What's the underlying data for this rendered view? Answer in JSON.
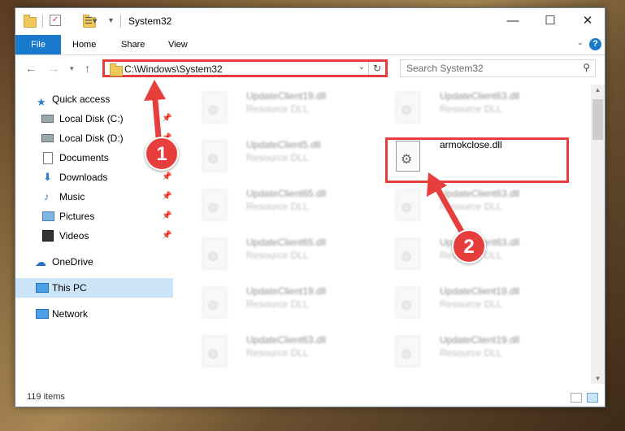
{
  "window": {
    "title": "System32",
    "controls": {
      "minimize": "—",
      "maximize": "☐",
      "close": "✕"
    }
  },
  "ribbon": {
    "tabs": [
      "File",
      "Home",
      "Share",
      "View"
    ],
    "help": "?"
  },
  "address": {
    "path": "C:\\Windows\\System32",
    "search_placeholder": "Search System32"
  },
  "nav_pane": {
    "items": [
      {
        "label": "Quick access",
        "icon": "star-icon",
        "pinned": false
      },
      {
        "label": "Local Disk (C:)",
        "icon": "drive-icon",
        "pinned": true
      },
      {
        "label": "Local Disk (D:)",
        "icon": "drive-icon",
        "pinned": true
      },
      {
        "label": "Documents",
        "icon": "documents-icon",
        "pinned": true
      },
      {
        "label": "Downloads",
        "icon": "download-icon",
        "pinned": true
      },
      {
        "label": "Music",
        "icon": "music-icon",
        "pinned": true
      },
      {
        "label": "Pictures",
        "icon": "pictures-icon",
        "pinned": true
      },
      {
        "label": "Videos",
        "icon": "videos-icon",
        "pinned": true
      },
      {
        "label": "OneDrive",
        "icon": "cloud-icon",
        "pinned": false
      },
      {
        "label": "This PC",
        "icon": "computer-icon",
        "pinned": false,
        "selected": true
      },
      {
        "label": "Network",
        "icon": "network-icon",
        "pinned": false
      }
    ]
  },
  "files": {
    "left_column": [
      {
        "name": "UpdateClient19.dll",
        "type": "Resource DLL"
      },
      {
        "name": "UpdateClient5.dll",
        "type": "Resource DLL"
      },
      {
        "name": "UpdateClient65.dll",
        "type": "Resource DLL"
      },
      {
        "name": "UpdateClient65.dll",
        "type": "Resource DLL"
      },
      {
        "name": "UpdateClient19.dll",
        "type": "Resource DLL"
      },
      {
        "name": "UpdateClient63.dll",
        "type": "Resource DLL"
      }
    ],
    "right_column": [
      {
        "name": "UpdateClient63.dll",
        "type": "Resource DLL"
      },
      {
        "name": "armokclose.dll",
        "type": ""
      },
      {
        "name": "UpdateClient63.dll",
        "type": "Resource DLL"
      },
      {
        "name": "UpdateClient63.dll",
        "type": "Resource DLL"
      },
      {
        "name": "UpdateClient19.dll",
        "type": "Resource DLL"
      },
      {
        "name": "UpdateClient19.dll",
        "type": "Resource DLL"
      }
    ]
  },
  "status": {
    "item_count": "119 items"
  },
  "callouts": {
    "one": "1",
    "two": "2"
  },
  "colors": {
    "accent": "#1979ca",
    "highlight": "#e63d3d",
    "selection": "#cce4f7"
  }
}
